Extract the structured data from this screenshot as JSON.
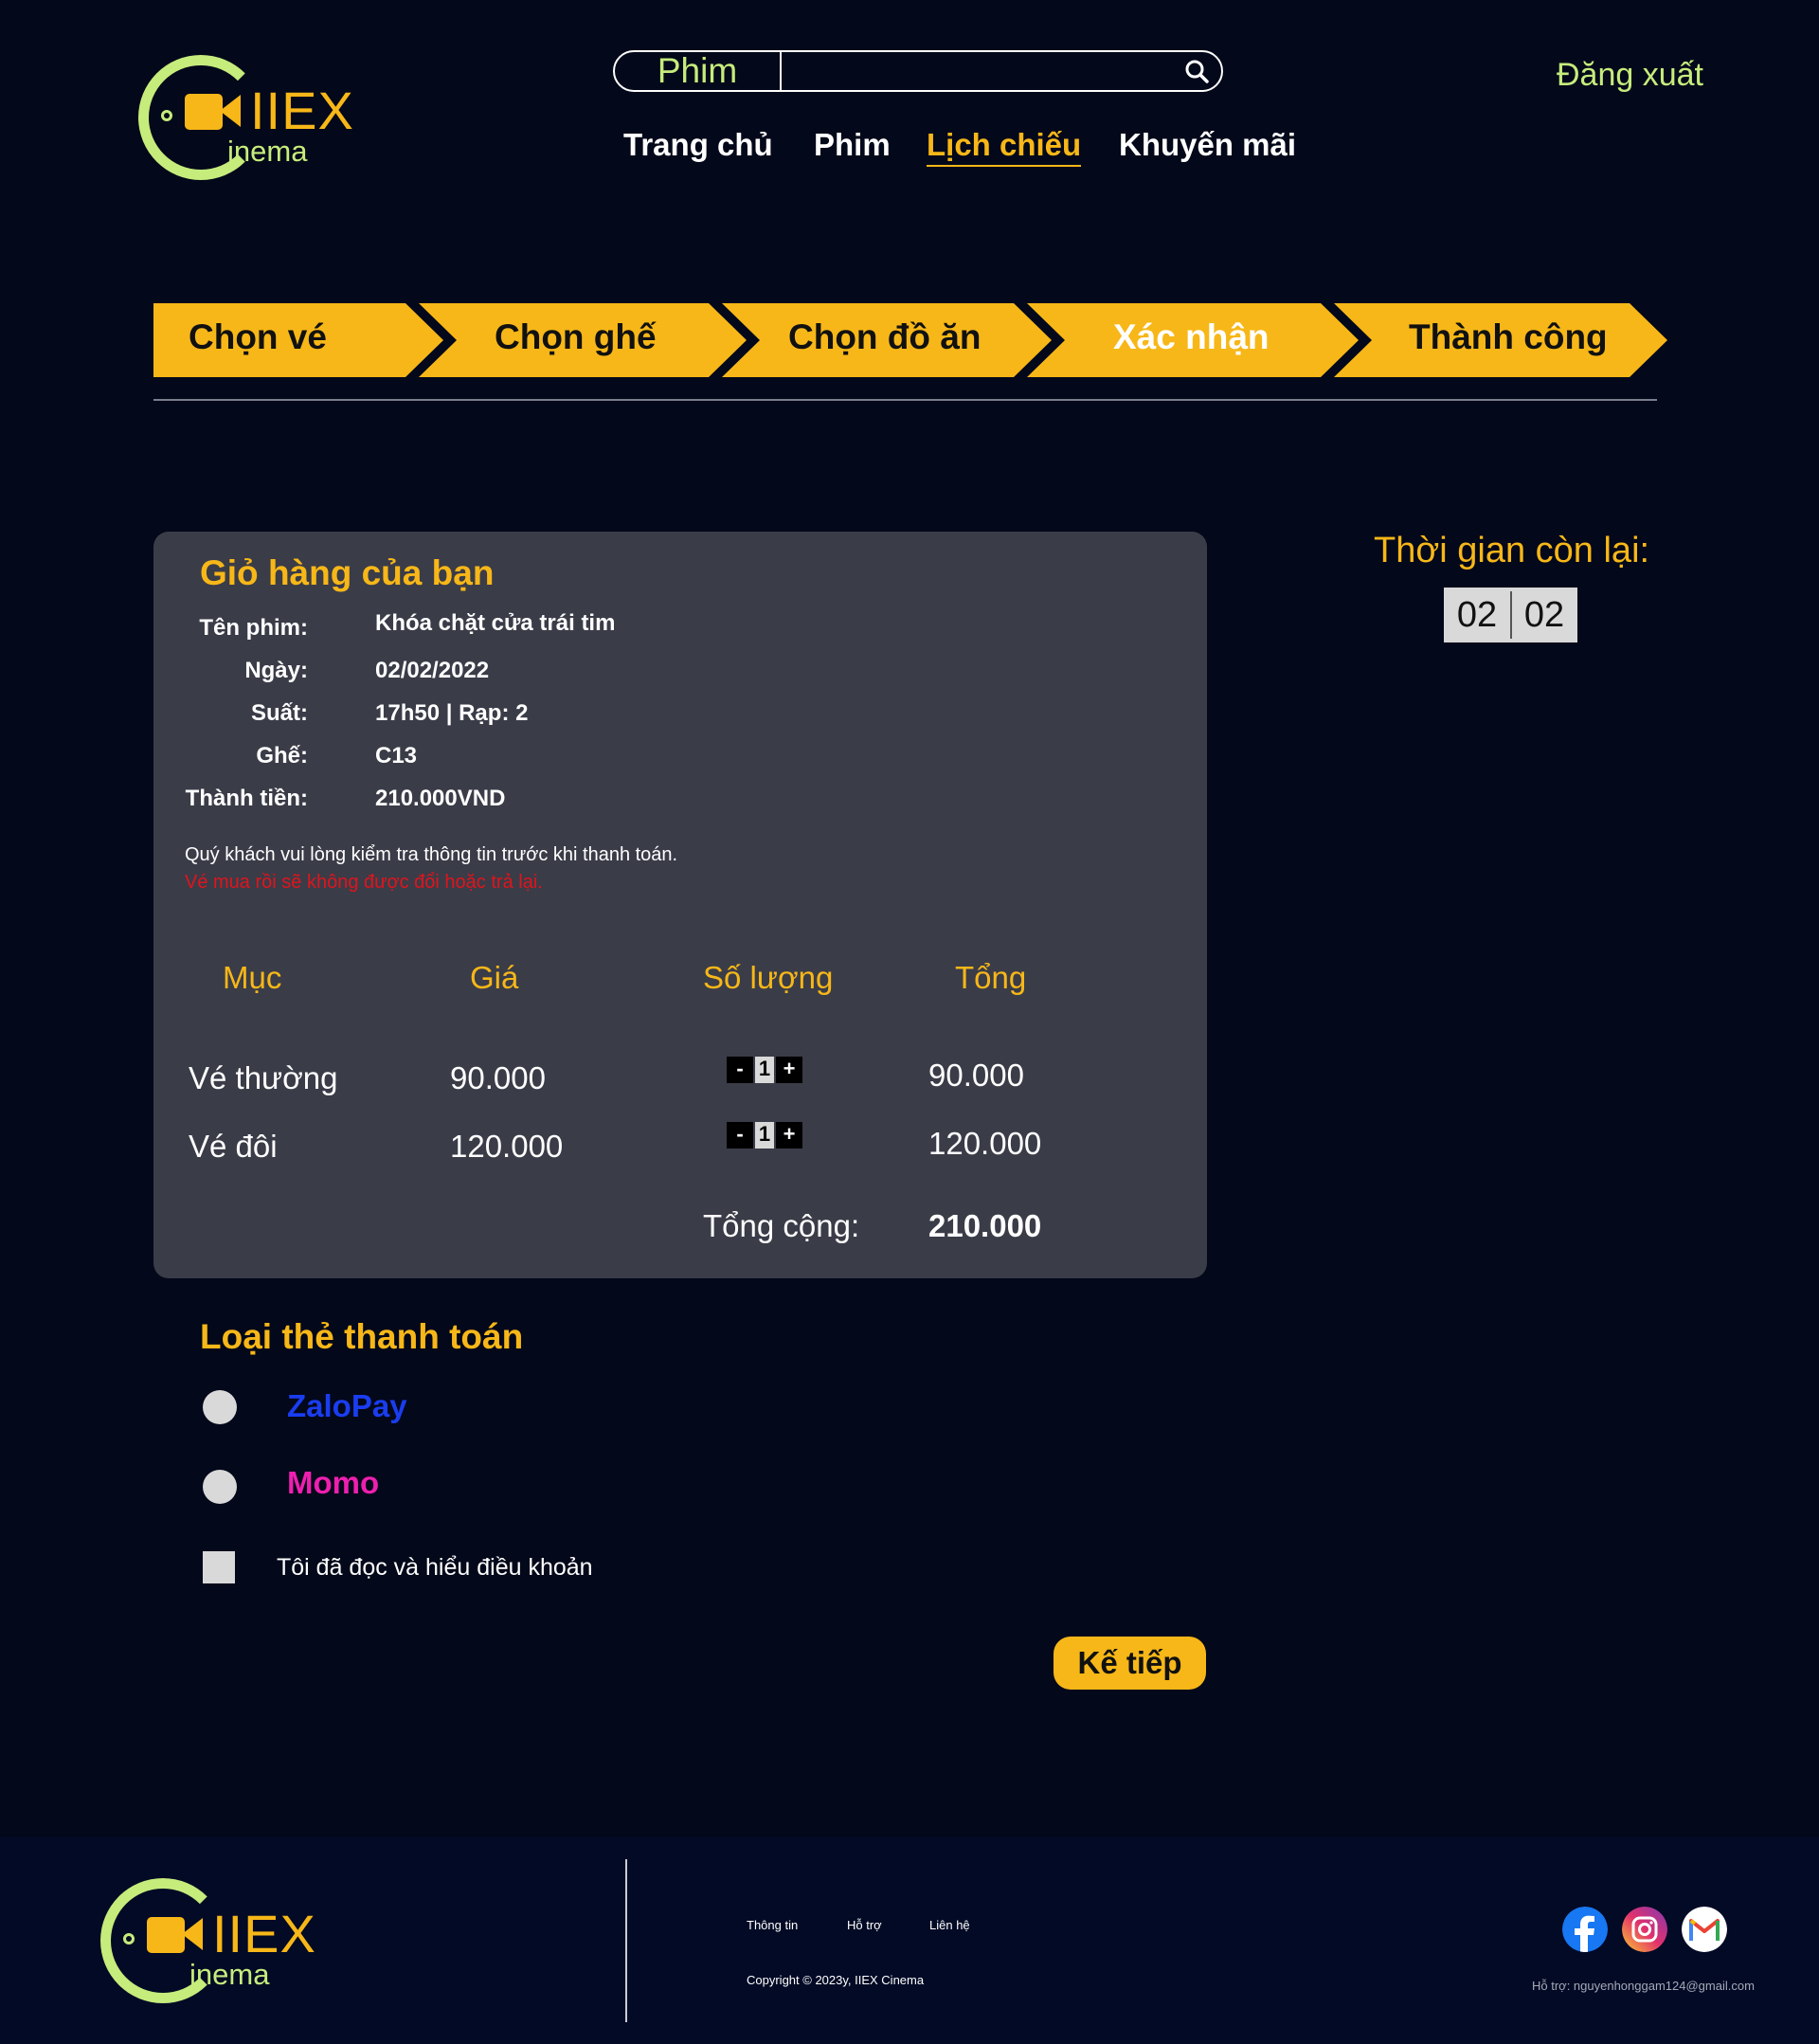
{
  "header": {
    "logo_main": "IIEX",
    "logo_sub": "inema",
    "search_label": "Phim",
    "search_placeholder": "",
    "logout": "Đăng xuất",
    "nav": [
      {
        "label": "Trang chủ",
        "active": false
      },
      {
        "label": "Phim",
        "active": false
      },
      {
        "label": "Lịch chiếu",
        "active": true
      },
      {
        "label": "Khuyến mãi",
        "active": false
      }
    ]
  },
  "steps": [
    "Chọn vé",
    "Chọn ghế",
    "Chọn đồ ăn",
    "Xác nhận",
    "Thành công"
  ],
  "cart": {
    "title": "Giỏ hàng của bạn",
    "info": [
      {
        "label": "Tên phim:",
        "value": "Khóa chặt cửa trái tim"
      },
      {
        "label": "Ngày:",
        "value": "02/02/2022"
      },
      {
        "label": "Suất:",
        "value": "17h50 | Rạp: 2"
      },
      {
        "label": "Ghế:",
        "value": "C13"
      },
      {
        "label": "Thành tiền:",
        "value": "210.000VND"
      }
    ],
    "notice": "Quý khách vui lòng kiểm tra thông tin trước khi thanh toán.",
    "warning": "Vé mua rồi sẽ không được đổi hoặc trả lại.",
    "columns": [
      "Mục",
      "Giá",
      "Số lượng",
      "Tổng"
    ],
    "rows": [
      {
        "item": "Vé thường",
        "price": "90.000",
        "qty": "1",
        "total": "90.000"
      },
      {
        "item": "Vé đôi",
        "price": "120.000",
        "qty": "1",
        "total": "120.000"
      }
    ],
    "stepper_minus": "-",
    "stepper_plus": "+",
    "grand_total_label": "Tổng cộng:",
    "grand_total": "210.000"
  },
  "timer": {
    "label": "Thời gian còn lại:",
    "minutes": "02",
    "seconds": "02"
  },
  "payment": {
    "title": "Loại thẻ thanh toán",
    "options": [
      {
        "label": "ZaloPay",
        "color": "#1a3df0"
      },
      {
        "label": "Momo",
        "color": "#ee1fb0"
      }
    ],
    "terms": "Tôi đã đọc và hiểu điều khoản",
    "next": "Kế tiếp"
  },
  "footer": {
    "links": [
      "Thông tin",
      "Hỗ trợ",
      "Liên hệ"
    ],
    "copyright": "Copyright © 2023y, IIEX Cinema",
    "support": "Hỗ trợ: nguyenhonggam124@gmail.com",
    "social_icons": [
      "facebook-icon",
      "instagram-icon",
      "gmail-icon"
    ]
  },
  "colors": {
    "background": "#03081a",
    "accent": "#f7b718",
    "logo_green": "#c6ec7c",
    "panel": "#3a3c48",
    "warning": "#e0141c"
  }
}
